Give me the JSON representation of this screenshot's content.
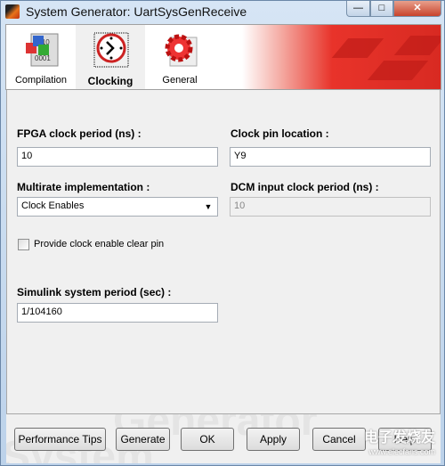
{
  "window": {
    "title": "System Generator: UartSysGenReceive",
    "controls": [
      "minimize",
      "maximize",
      "close"
    ]
  },
  "tabs": [
    {
      "label": "Compilation",
      "icon": "compilation-binary-icon",
      "active": false
    },
    {
      "label": "Clocking",
      "icon": "clock-icon",
      "active": true
    },
    {
      "label": "General",
      "icon": "gear-icon",
      "active": false
    }
  ],
  "clocking": {
    "fpga_period_label": "FPGA clock period (ns) :",
    "fpga_period_value": "10",
    "clock_pin_label": "Clock pin location :",
    "clock_pin_value": "Y9",
    "multirate_label": "Multirate implementation :",
    "multirate_value": "Clock Enables",
    "dcm_label": "DCM input clock period (ns) :",
    "dcm_value": "10",
    "clear_pin_label": "Provide clock enable clear pin",
    "clear_pin_checked": false,
    "simulink_label": "Simulink system period (sec) :",
    "simulink_value": "1/104160"
  },
  "buttons": {
    "performance": "Performance Tips",
    "generate": "Generate",
    "ok": "OK",
    "apply": "Apply",
    "cancel": "Cancel",
    "help": "Help"
  },
  "watermark": {
    "text": "电子发烧友",
    "url": "www.elecfans.com"
  },
  "colors": {
    "banner_red": "#d82a22",
    "titlebar": "#c9dbee"
  }
}
